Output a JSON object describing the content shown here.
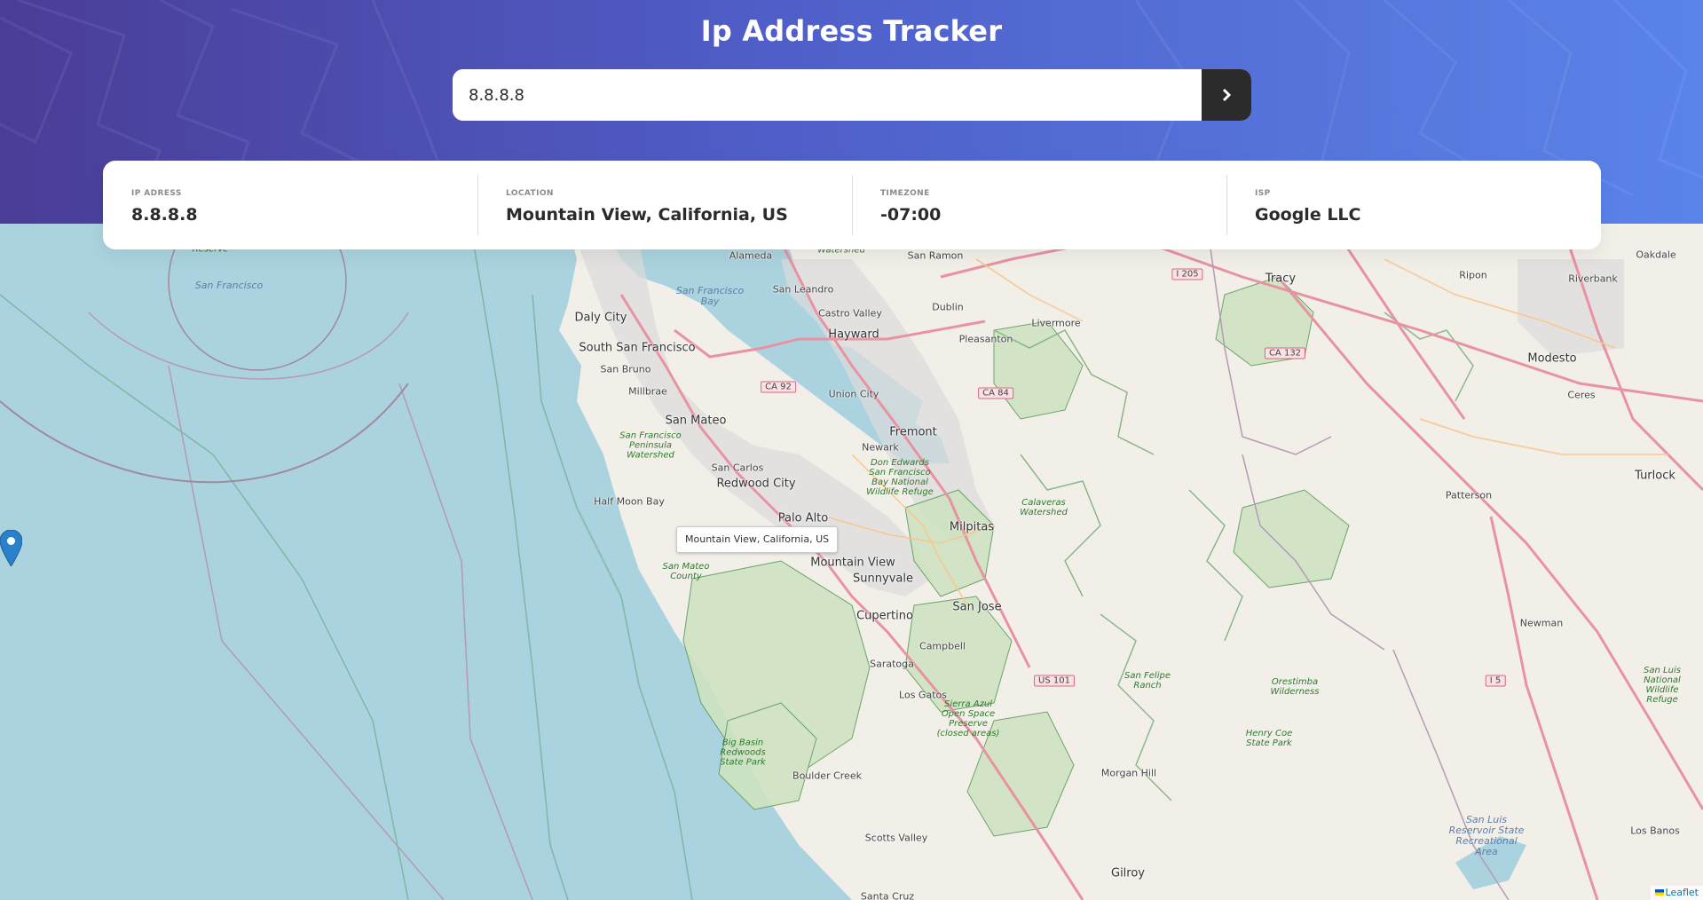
{
  "app": {
    "title": "Ip Address Tracker"
  },
  "search": {
    "value": "8.8.8.8",
    "button_icon": "chevron-right-icon"
  },
  "info": {
    "ip": {
      "label": "IP ADRESS",
      "value": "8.8.8.8"
    },
    "location": {
      "label": "LOCATION",
      "value": "Mountain View, California, US"
    },
    "timezone": {
      "label": "TIMEZONE",
      "value": "-07:00"
    },
    "isp": {
      "label": "ISP",
      "value": "Google LLC"
    }
  },
  "map": {
    "popup_text": "Mountain View, California, US",
    "attribution": "Leaflet",
    "cities": [
      "Daly City",
      "South San Francisco",
      "San Mateo",
      "Redwood City",
      "Palo Alto",
      "Mountain View",
      "Sunnyvale",
      "Cupertino",
      "San Jose",
      "Milpitas",
      "Fremont",
      "Hayward",
      "Tracy",
      "Modesto",
      "Turlock",
      "Gilroy"
    ],
    "towns": [
      "Alameda",
      "San Leandro",
      "Castro Valley",
      "Dublin",
      "Pleasanton",
      "Livermore",
      "Union City",
      "Newark",
      "San Bruno",
      "Millbrae",
      "San Carlos",
      "Half Moon Bay",
      "Campbell",
      "Saratoga",
      "Los Gatos",
      "Boulder Creek",
      "Scotts Valley",
      "Morgan Hill",
      "Patterson",
      "Newman",
      "Ceres",
      "Ripon",
      "Riverbank",
      "Oakdale",
      "Los Banos",
      "San Ramon",
      "Santa Cruz"
    ],
    "green_labels": [
      "San Francisco Peninsula Watershed",
      "Don Edwards San Francisco Bay National Wildlife Refuge",
      "Calaveras Watershed",
      "Sierra Azul Open Space Preserve (closed areas)",
      "Big Basin Redwoods State Park",
      "San Felipe Ranch",
      "Orestimba Wilderness",
      "Henry Coe State Park",
      "San Luis National Wildlife Refuge",
      "San Mateo County",
      "Reserve",
      "Watershed"
    ],
    "water_labels": [
      "San Francisco Bay",
      "San Luis Reservoir State Recreational Area",
      "San Francisco"
    ],
    "shields": [
      "I 205",
      "CA 132",
      "CA 92",
      "CA 84",
      "US 101",
      "I 5"
    ]
  },
  "colors": {
    "header_start": "#4a3d97",
    "header_end": "#5a84ea",
    "dark": "#2b2b2b",
    "ocean": "#aad3df",
    "land": "#f2efe9"
  }
}
